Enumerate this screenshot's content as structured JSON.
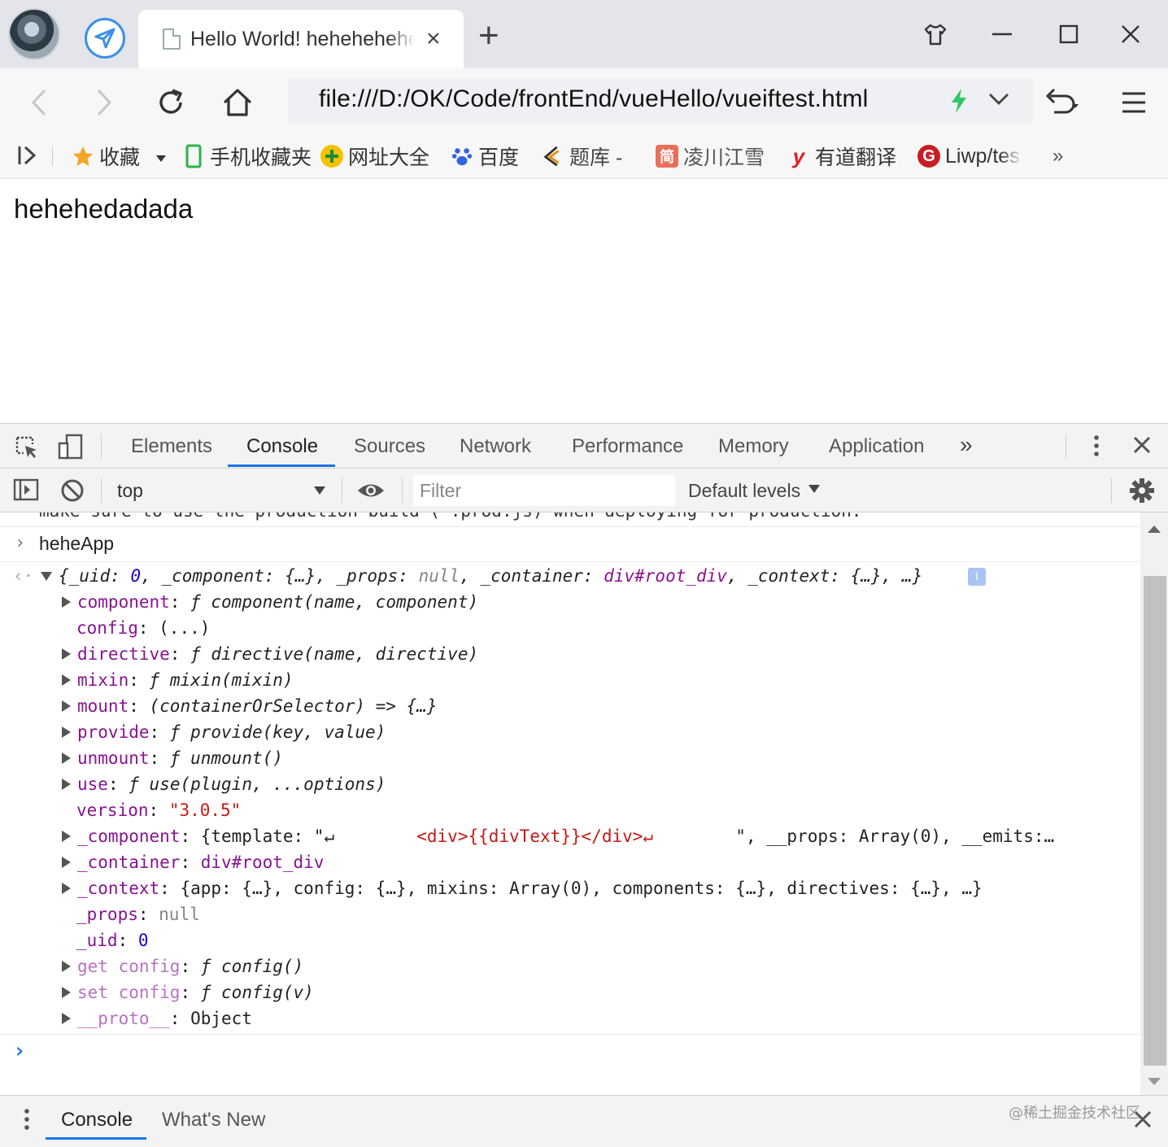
{
  "browser": {
    "tab_title": "Hello World! hehehehehe",
    "tab_close": "×",
    "new_tab": "+",
    "url": "file:///D:/OK/Code/frontEnd/vueHello/vueiftest.html"
  },
  "bookmarks": [
    {
      "label": "收藏",
      "icon": "star-icon",
      "color": "#f5a623"
    },
    {
      "label": "手机收藏夹",
      "icon": "phone-icon",
      "color": "#2cb34a"
    },
    {
      "label": "网址大全",
      "icon": "plus-circle-icon",
      "color": "#2ea043"
    },
    {
      "label": "百度",
      "icon": "baidu-paw-icon",
      "color": "#3064e0"
    },
    {
      "label": "题库 -",
      "icon": "book-icon",
      "color": "#f08c00"
    },
    {
      "label": "凌川江雪",
      "icon": "jianshu-icon",
      "color": "#ea6f5a"
    },
    {
      "label": "有道翻译",
      "icon": "youdao-icon",
      "color": "#e02020"
    },
    {
      "label": "Liwp/tes",
      "icon": "gitee-icon",
      "color": "#c71d23"
    }
  ],
  "bookmarks_more": "»",
  "page": {
    "text": "hehehedadada"
  },
  "devtools": {
    "tabs": [
      "Elements",
      "Console",
      "Sources",
      "Network",
      "Performance",
      "Memory",
      "Application"
    ],
    "more_tabs": "»",
    "context": "top",
    "filter_placeholder": "Filter",
    "levels": "Default levels",
    "accent": "#1a73e8"
  },
  "console": {
    "truncated_line": "make sure to use the production build (*.prod.js) when deploying for production.",
    "input_echo": "heheApp",
    "summary": {
      "open": "{",
      "uid_key": "_uid",
      "uid_val": "0",
      "component_key": "_component",
      "component_val": "{…}",
      "props_key": "_props",
      "props_val": "null",
      "container_key": "_container",
      "container_val": "div#root_div",
      "context_key": "_context",
      "context_val": "{…}",
      "tail": "…}"
    },
    "props": [
      {
        "key": "component",
        "sep": ": ",
        "f": "ƒ ",
        "val": "component(name, component)"
      },
      {
        "key": "config",
        "sep": ": ",
        "val": "(...)"
      },
      {
        "key": "directive",
        "sep": ": ",
        "f": "ƒ ",
        "val": "directive(name, directive)"
      },
      {
        "key": "mixin",
        "sep": ": ",
        "f": "ƒ ",
        "val": "mixin(mixin)"
      },
      {
        "key": "mount",
        "sep": ": ",
        "val": "(containerOrSelector) => {…}"
      },
      {
        "key": "provide",
        "sep": ": ",
        "f": "ƒ ",
        "val": "provide(key, value)"
      },
      {
        "key": "unmount",
        "sep": ": ",
        "f": "ƒ ",
        "val": "unmount()"
      },
      {
        "key": "use",
        "sep": ": ",
        "f": "ƒ ",
        "val": "use(plugin, ...options)"
      },
      {
        "key": "version",
        "sep": ": ",
        "val": "\"3.0.5\""
      },
      {
        "key": "_component",
        "sep": ": ",
        "val_a": "{template: \"↵        ",
        "val_str": "<div>{{divText}}</div>↵",
        "val_b": "        \", __props: Array(0), __emits:…"
      },
      {
        "key": "_container",
        "sep": ": ",
        "val": "div#root_div"
      },
      {
        "key": "_context",
        "sep": ": ",
        "val": "{app: {…}, config: {…}, mixins: Array(0), components: {…}, directives: {…}, …}"
      },
      {
        "key": "_props",
        "sep": ": ",
        "val": "null"
      },
      {
        "key": "_uid",
        "sep": ": ",
        "val": "0"
      },
      {
        "key": "get config",
        "sep": ": ",
        "f": "ƒ ",
        "val": "config()"
      },
      {
        "key": "set config",
        "sep": ": ",
        "f": "ƒ ",
        "val": "config(v)"
      },
      {
        "key": "__proto__",
        "sep": ": ",
        "val": "Object"
      }
    ],
    "prompt": "›"
  },
  "drawer": {
    "tabs": [
      "Console",
      "What's New"
    ]
  },
  "watermark": "@稀土掘金技术社区"
}
